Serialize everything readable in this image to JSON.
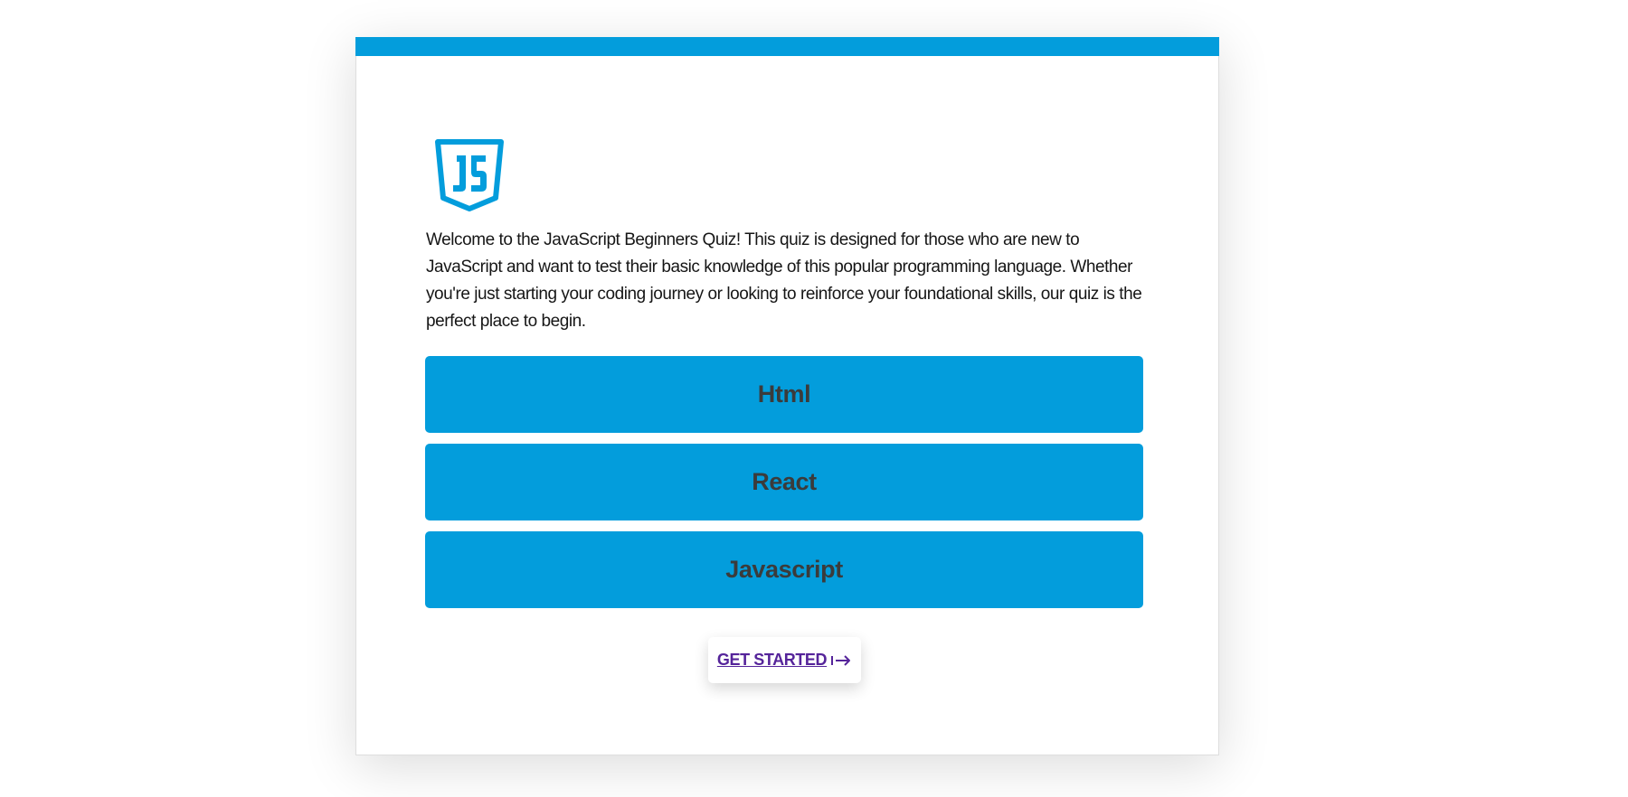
{
  "intro": {
    "text": "Welcome to the JavaScript Beginners Quiz! This quiz is designed for those who are new to JavaScript and want to test their basic knowledge of this popular programming language. Whether you're just starting your coding journey or looking to reinforce your foundational skills, our quiz is the perfect place to begin."
  },
  "options": [
    {
      "label": "Html"
    },
    {
      "label": "React"
    },
    {
      "label": "Javascript"
    }
  ],
  "actions": {
    "start_label": "GET STARTED"
  },
  "icons": {
    "logo": "javascript-shield-logo",
    "arrow": "arrow-right-to-bar-icon"
  },
  "colors": {
    "accent": "#039ddc",
    "button_text": "#3b3b3b",
    "link": "#55249a",
    "text": "#161616"
  }
}
